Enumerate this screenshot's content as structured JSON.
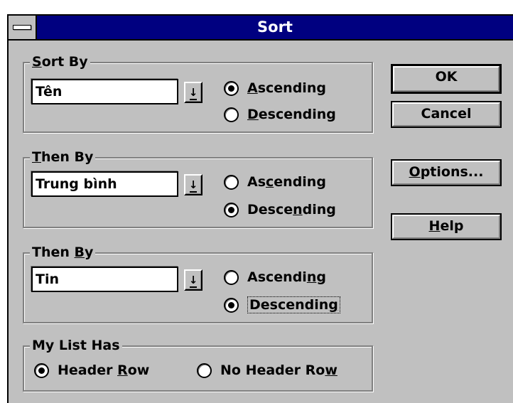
{
  "window": {
    "title": "Sort"
  },
  "sort_by": {
    "legend": "Sort By",
    "field": "Tên",
    "ascending_label": "Ascending",
    "descending_label": "Descending",
    "selected": "Ascending"
  },
  "then_by_1": {
    "legend": "Then By",
    "field": "Trung bình",
    "ascending_label": "Ascending",
    "descending_label": "Descending",
    "selected": "Descending"
  },
  "then_by_2": {
    "legend": "Then By",
    "field": "Tin",
    "ascending_label": "Ascending",
    "descending_label": "Descending",
    "selected": "Descending"
  },
  "my_list_has": {
    "legend": "My List Has",
    "header_row_label": "Header Row",
    "no_header_row_label": "No Header Row",
    "selected": "Header Row"
  },
  "buttons": {
    "ok": "OK",
    "cancel": "Cancel",
    "options": "Options...",
    "help": "Help"
  },
  "icons": {
    "system_menu": "system-menu-icon",
    "dropdown": "dropdown-arrow-icon"
  },
  "colors": {
    "titlebar": "#000080",
    "dialog_face": "#c0c0c0",
    "title_text": "#ffffff"
  }
}
